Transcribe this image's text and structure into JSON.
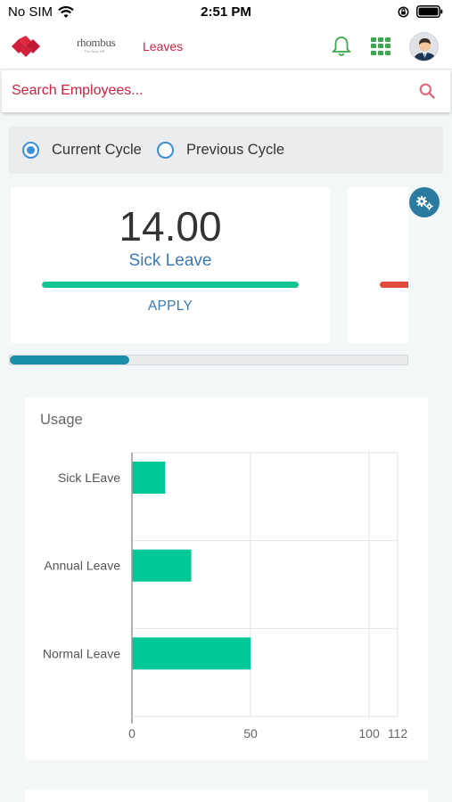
{
  "status_bar": {
    "carrier": "No SIM",
    "time": "2:51 PM"
  },
  "app_bar": {
    "brand_logo": "rhombus-diamonds-logo",
    "product_logo_word": "rhombus",
    "product_logo_tagline": "The New HR",
    "title": "Leaves",
    "icons": [
      "bell-icon",
      "apps-grid-icon",
      "avatar"
    ]
  },
  "search": {
    "placeholder": "Search Employees..."
  },
  "cycle": {
    "options": [
      {
        "label": "Current Cycle",
        "selected": true
      },
      {
        "label": "Previous Cycle",
        "selected": false
      }
    ]
  },
  "leave_cards": [
    {
      "count": "14.00",
      "type": "Sick Leave",
      "action": "APPLY",
      "bar_color": "#14c494"
    },
    {
      "bar_color": "#e04b3c"
    }
  ],
  "carousel": {
    "scroll_fraction": 0.3
  },
  "usage": {
    "title": "Usage"
  },
  "chart_data": {
    "type": "bar",
    "orientation": "horizontal",
    "categories": [
      "Sick LEave",
      "Annual Leave",
      "Normal Leave"
    ],
    "values": [
      14,
      25,
      50
    ],
    "xlim": [
      0,
      112
    ],
    "xticks": [
      "0",
      "50",
      "100",
      "112"
    ],
    "xtick_values": [
      0,
      50,
      100,
      112
    ],
    "grid": true,
    "bar_color": "#00c896"
  },
  "colors": {
    "brand_red": "#d0203d",
    "accent_blue": "#3b7ab8",
    "radio_blue": "#3a8fd6",
    "green": "#14c494"
  }
}
